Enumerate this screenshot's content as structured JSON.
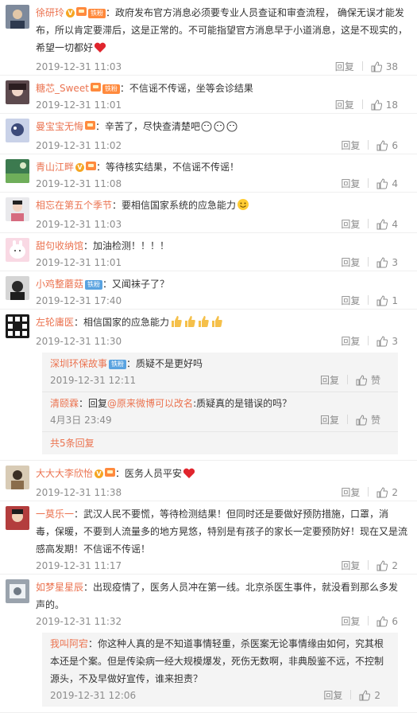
{
  "ui": {
    "reply_label": "回复",
    "zan_label": "赞"
  },
  "comments": [
    {
      "user": "徐研玲",
      "text": "政府发布官方消息必须要专业人员查证和审查流程， 确保无误才能发布，所以肯定要滞后，这是正常的。不可能指望官方消息早于小道消息，这是不现实的，希望一切都好",
      "time": "2019-12-31 11:03",
      "likes": "38",
      "fan_badge": "铁粉"
    },
    {
      "user": "糖芯_Sweet",
      "text": "不信谣不传谣，坐等会诊结果",
      "time": "2019-12-31 11:01",
      "likes": "18",
      "fan_badge": "铁粉"
    },
    {
      "user": "曼宝宝无悔",
      "text": "辛苦了，尽快查清楚吧",
      "time": "2019-12-31 11:02",
      "likes": "6"
    },
    {
      "user": "青山江畔",
      "text": "等待核实结果，不信谣不传谣！",
      "time": "2019-12-31 11:08",
      "likes": "4"
    },
    {
      "user": "相忘在第五个季节",
      "text": "要相信国家系统的应急能力",
      "time": "2019-12-31 11:03",
      "likes": "4"
    },
    {
      "user": "甜句收纳馆",
      "text": "加油检测！！！！",
      "time": "2019-12-31 11:01",
      "likes": "3"
    },
    {
      "user": "小鸡整蘑菇",
      "text": "又闻袜子了？",
      "time": "2019-12-31 17:40",
      "likes": "1",
      "fan_badge": "铁粉"
    },
    {
      "user": "左轮庸医",
      "text": "相信国家的应急能力",
      "time": "2019-12-31 11:30",
      "likes": "3"
    },
    {
      "user": "大大大李欣怡",
      "text": "医务人员平安",
      "time": "2019-12-31 11:38",
      "likes": "2"
    },
    {
      "user": "一莫乐一",
      "text": "武汉人民不要慌，等待检测结果！但同时还是要做好预防措施，口罩，消毒，保暖，不要到人流量多的地方晃悠，特别是有孩子的家长一定要预防好！现在又是流感高发期！不信谣不传谣！",
      "time": "2019-12-31 11:17",
      "likes": "2"
    },
    {
      "user": "如梦星星辰",
      "text": "出现疫情了，医务人员冲在第一线。北京杀医生事件，就没看到那么多发声的。",
      "time": "2019-12-31 11:32",
      "likes": "6"
    }
  ],
  "replies_8": [
    {
      "user": "深圳环保故事",
      "fan_badge": "铁粉",
      "text": "质疑不是更好吗",
      "time": "2019-12-31 12:11",
      "likes": "赞"
    },
    {
      "user": "清颐霖",
      "text_prefix": "回复",
      "at_user": "@原来微博可以改名",
      "text_suffix": ":质疑真的是错误的吗？",
      "time": "4月3日 23:49",
      "likes": "赞"
    }
  ],
  "more_replies_8": "共5条回复",
  "replies_10": [
    {
      "user": "我叫阿宕",
      "text": "你这种人真的是不知道事情轻重，杀医案无论事情缘由如何，究其根本还是个案。但是传染病一经大规模爆发，死伤无数啊，非典殷鉴不远，不控制源头，不及早做好宣传，谁来担责？",
      "time": "2019-12-31 12:06",
      "likes": "2"
    }
  ],
  "colors": {
    "accent": "#eb7350",
    "time": "#8c8c8c",
    "sub_bg": "#f4f4f4"
  }
}
